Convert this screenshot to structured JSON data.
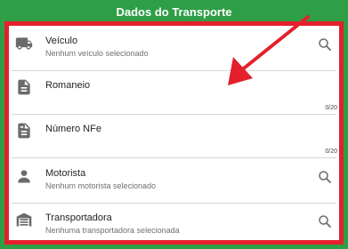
{
  "header": {
    "title": "Dados do Transporte"
  },
  "fields": [
    {
      "label": "Veículo",
      "subtitle": "Nenhum veículo selecionado",
      "icon": "truck-icon"
    },
    {
      "label": "Romaneio",
      "counter": "0/20",
      "icon": "document-icon"
    },
    {
      "label": "Número NFe",
      "counter": "0/20",
      "icon": "receipt-icon"
    },
    {
      "label": "Motorista",
      "subtitle": "Nenhum motorista selecionado",
      "icon": "person-icon"
    },
    {
      "label": "Transportadora",
      "subtitle": "Nenhuma transportadora selecionada",
      "icon": "warehouse-icon"
    }
  ],
  "colors": {
    "header_bg": "#2e9e47",
    "highlight": "#e3202b",
    "icon": "#6b6b6b"
  }
}
